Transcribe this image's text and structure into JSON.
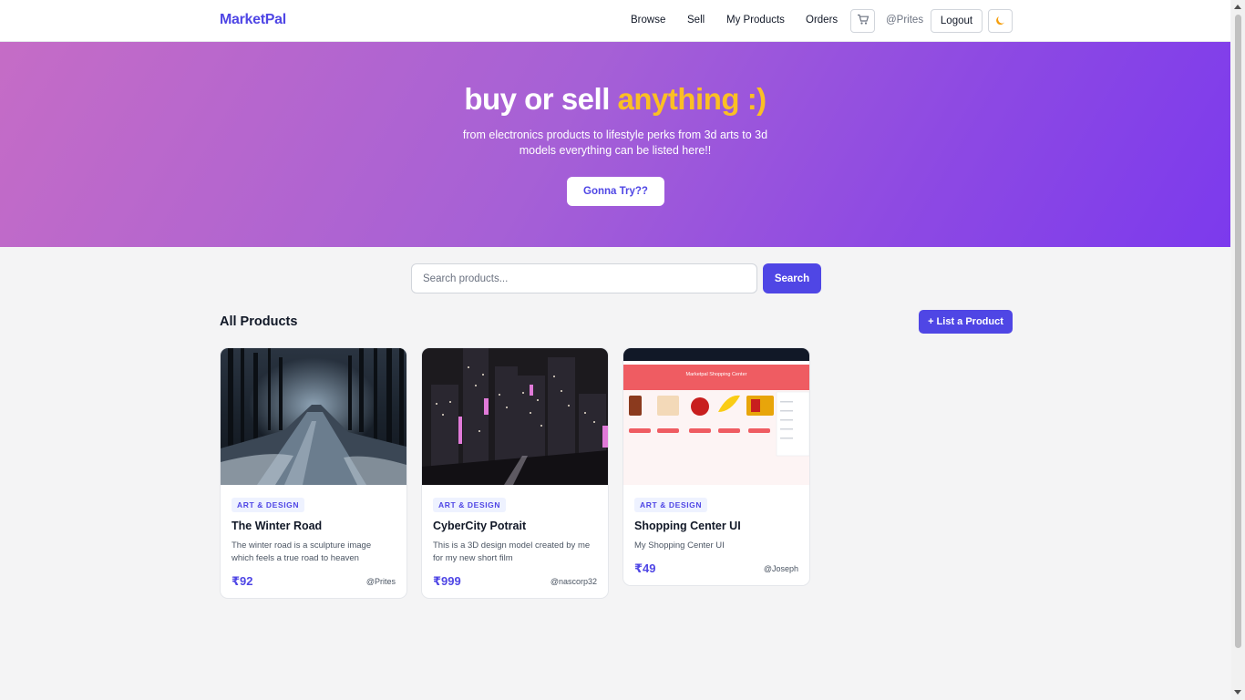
{
  "nav": {
    "logo": "MarketPal",
    "links": [
      "Browse",
      "Sell",
      "My Products",
      "Orders"
    ],
    "cart_icon": "shopping-cart-icon",
    "user": "@Prites",
    "logout_label": "Logout",
    "theme_icon": "moon-icon"
  },
  "hero": {
    "title_part1": "buy or sell ",
    "title_part2": "anything :)",
    "subtitle": "from electronics products to lifestyle perks from 3d arts to 3d models everything can be listed here!!",
    "cta_label": "Gonna Try??"
  },
  "search": {
    "placeholder": "Search products...",
    "value": "",
    "button_label": "Search"
  },
  "section": {
    "title": "All Products",
    "list_button_label": "+ List a Product"
  },
  "products": [
    {
      "category": "ART & DESIGN",
      "title": "The Winter Road",
      "description": "The winter road is a sculpture image which feels a true road to heaven",
      "price": "₹92",
      "seller": "@Prites"
    },
    {
      "category": "ART & DESIGN",
      "title": "CyberCity Potrait",
      "description": "This is a 3D design model created by me for my new short film",
      "price": "₹999",
      "seller": "@nascorp32"
    },
    {
      "category": "ART & DESIGN",
      "title": "Shopping Center UI",
      "description": "My Shopping Center UI",
      "price": "₹49",
      "seller": "@Joseph",
      "thumbnail_text": "Marketpal Shopping Center"
    }
  ],
  "colors": {
    "brand": "#4f46e5",
    "accent": "#fbbf24",
    "hero_start": "#c56cc6",
    "hero_end": "#7c3aed"
  }
}
